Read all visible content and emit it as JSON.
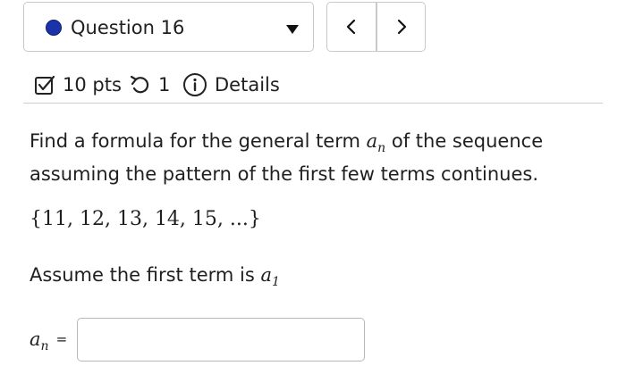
{
  "question_selector": {
    "label": "Question 16",
    "dot_color": "#1a33a8"
  },
  "nav": {
    "prev_icon": "chevron-left-icon",
    "next_icon": "chevron-right-icon"
  },
  "meta": {
    "points": "10 pts",
    "attempts": "1",
    "details": "Details"
  },
  "prompt": {
    "before": "Find a formula for the general term ",
    "term_base": "a",
    "term_sub": "n",
    "after": " of the sequence assuming the pattern of the first few terms continues."
  },
  "sequence": "{11, 12, 13, 14, 15, ...}",
  "assume": {
    "text": "Assume the first term is ",
    "term_base": "a",
    "term_sub": "1"
  },
  "answer": {
    "var_base": "a",
    "var_sub": "n",
    "equals": "=",
    "value": ""
  }
}
